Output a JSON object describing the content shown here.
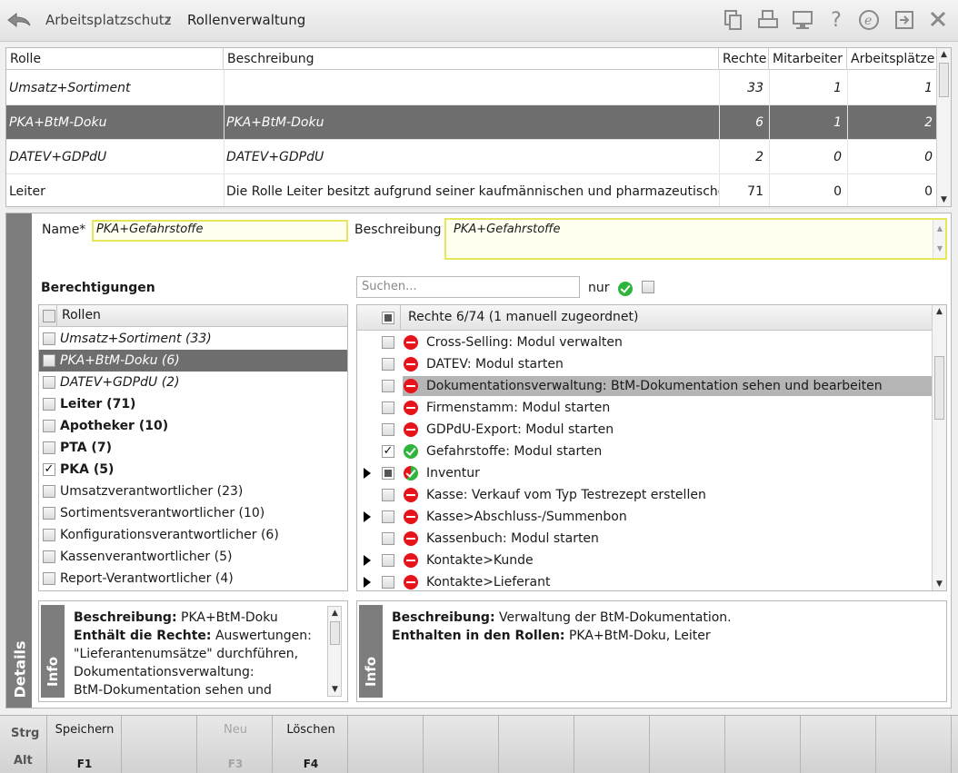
{
  "breadcrumb": {
    "parent": "Arbeitsplatzschutz",
    "separator": "›",
    "current": "Rollenverwaltung"
  },
  "toolbar_icons": [
    "copy-icon",
    "print-icon",
    "monitor-icon",
    "help-icon",
    "e-icon",
    "export-icon",
    "close-icon"
  ],
  "roles_table": {
    "columns": [
      "Rolle",
      "Beschreibung",
      "Rechte",
      "Mitarbeiter",
      "Arbeitsplätze"
    ],
    "rows": [
      {
        "rolle": "Umsatz+Sortiment",
        "beschreibung": "",
        "rechte": "33",
        "mitarbeiter": "1",
        "arbeitsplaetze": "1",
        "italic": true,
        "selected": false
      },
      {
        "rolle": "PKA+BtM-Doku",
        "beschreibung": "PKA+BtM-Doku",
        "rechte": "6",
        "mitarbeiter": "1",
        "arbeitsplaetze": "2",
        "italic": true,
        "selected": true
      },
      {
        "rolle": "DATEV+GDPdU",
        "beschreibung": "DATEV+GDPdU",
        "rechte": "2",
        "mitarbeiter": "0",
        "arbeitsplaetze": "0",
        "italic": true,
        "selected": false
      },
      {
        "rolle": "Leiter",
        "beschreibung": "Die Rolle Leiter besitzt aufgrund seiner kaufmännischen und pharmazeutischen Ve",
        "rechte": "71",
        "mitarbeiter": "0",
        "arbeitsplaetze": "0",
        "italic": false,
        "selected": false
      }
    ]
  },
  "details": {
    "tab_label": "Details",
    "name_label": "Name*",
    "name_value": "PKA+Gefahrstoffe",
    "beschreibung_label": "Beschreibung",
    "beschreibung_value": "PKA+Gefahrstoffe",
    "berechtigungen_label": "Berechtigungen",
    "search_placeholder": "Suchen...",
    "nur_label": "nur"
  },
  "roles_list": {
    "header": "Rollen",
    "items": [
      {
        "label": "Umsatz+Sortiment (33)",
        "style": "italic",
        "checked": false,
        "selected": false
      },
      {
        "label": "PKA+BtM-Doku (6)",
        "style": "italic",
        "checked": false,
        "selected": true
      },
      {
        "label": "DATEV+GDPdU (2)",
        "style": "italic",
        "checked": false,
        "selected": false
      },
      {
        "label": "Leiter (71)",
        "style": "bold",
        "checked": false,
        "selected": false
      },
      {
        "label": "Apotheker (10)",
        "style": "bold",
        "checked": false,
        "selected": false
      },
      {
        "label": "PTA (7)",
        "style": "bold",
        "checked": false,
        "selected": false
      },
      {
        "label": "PKA (5)",
        "style": "bold",
        "checked": true,
        "selected": false
      },
      {
        "label": "Umsatzverantwortlicher (23)",
        "style": "normal",
        "checked": false,
        "selected": false
      },
      {
        "label": "Sortimentsverantwortlicher (10)",
        "style": "normal",
        "checked": false,
        "selected": false
      },
      {
        "label": "Konfigurationsverantwortlicher (6)",
        "style": "normal",
        "checked": false,
        "selected": false
      },
      {
        "label": "Kassenverantwortlicher (5)",
        "style": "normal",
        "checked": false,
        "selected": false
      },
      {
        "label": "Report-Verantwortlicher (4)",
        "style": "normal",
        "checked": false,
        "selected": false
      }
    ]
  },
  "rights_list": {
    "header": "Rechte 6/74 (1 manuell zugeordnet)",
    "items": [
      {
        "label": "Cross-Selling: Modul verwalten",
        "status": "no",
        "checked": false,
        "expand": false,
        "selected": false
      },
      {
        "label": "DATEV: Modul starten",
        "status": "no",
        "checked": false,
        "expand": false,
        "selected": false
      },
      {
        "label": "Dokumentationsverwaltung: BtM-Dokumentation sehen und bearbeiten",
        "status": "no",
        "checked": false,
        "expand": false,
        "selected": true
      },
      {
        "label": "Firmenstamm: Modul starten",
        "status": "no",
        "checked": false,
        "expand": false,
        "selected": false
      },
      {
        "label": "GDPdU-Export: Modul starten",
        "status": "no",
        "checked": false,
        "expand": false,
        "selected": false
      },
      {
        "label": "Gefahrstoffe: Modul starten",
        "status": "ok",
        "checked": true,
        "expand": false,
        "selected": false
      },
      {
        "label": "Inventur",
        "status": "mixed",
        "checked": "partial",
        "expand": true,
        "selected": false
      },
      {
        "label": "Kasse: Verkauf vom Typ Testrezept erstellen",
        "status": "no",
        "checked": false,
        "expand": false,
        "selected": false
      },
      {
        "label": "Kasse>Abschluss-/Summenbon",
        "status": "no",
        "checked": false,
        "expand": true,
        "selected": false
      },
      {
        "label": "Kassenbuch: Modul starten",
        "status": "no",
        "checked": false,
        "expand": false,
        "selected": false
      },
      {
        "label": "Kontakte>Kunde",
        "status": "no",
        "checked": false,
        "expand": true,
        "selected": false
      },
      {
        "label": "Kontakte>Lieferant",
        "status": "no",
        "checked": false,
        "expand": true,
        "selected": false
      }
    ]
  },
  "info_left": {
    "tab_label": "Info",
    "lines": [
      {
        "bold": "Beschreibung:",
        "text": " PKA+BtM-Doku"
      },
      {
        "bold": "Enthält die Rechte:",
        "text": " Auswertungen:"
      },
      {
        "bold": "",
        "text": "\"Lieferantenumsätze\" durchführen,"
      },
      {
        "bold": "",
        "text": "Dokumentationsverwaltung:"
      },
      {
        "bold": "",
        "text": "BtM-Dokumentation sehen und"
      }
    ]
  },
  "info_right": {
    "tab_label": "Info",
    "lines": [
      {
        "bold": "Beschreibung:",
        "text": " Verwaltung der BtM-Dokumentation."
      },
      {
        "bold": "Enthalten in den Rollen:",
        "text": " PKA+BtM-Doku, Leiter"
      }
    ]
  },
  "function_bar": {
    "strg": "Strg",
    "alt": "Alt",
    "keys": [
      {
        "label": "Speichern",
        "key": "F1",
        "enabled": true
      },
      {
        "label": "",
        "key": "",
        "enabled": true
      },
      {
        "label": "Neu",
        "key": "F3",
        "enabled": false
      },
      {
        "label": "Löschen",
        "key": "F4",
        "enabled": true
      },
      {
        "label": "",
        "key": "",
        "enabled": true
      },
      {
        "label": "",
        "key": "",
        "enabled": true
      },
      {
        "label": "",
        "key": "",
        "enabled": true
      },
      {
        "label": "",
        "key": "",
        "enabled": true
      },
      {
        "label": "",
        "key": "",
        "enabled": true
      },
      {
        "label": "",
        "key": "",
        "enabled": true
      },
      {
        "label": "",
        "key": "",
        "enabled": true
      },
      {
        "label": "",
        "key": "",
        "enabled": true
      }
    ]
  }
}
